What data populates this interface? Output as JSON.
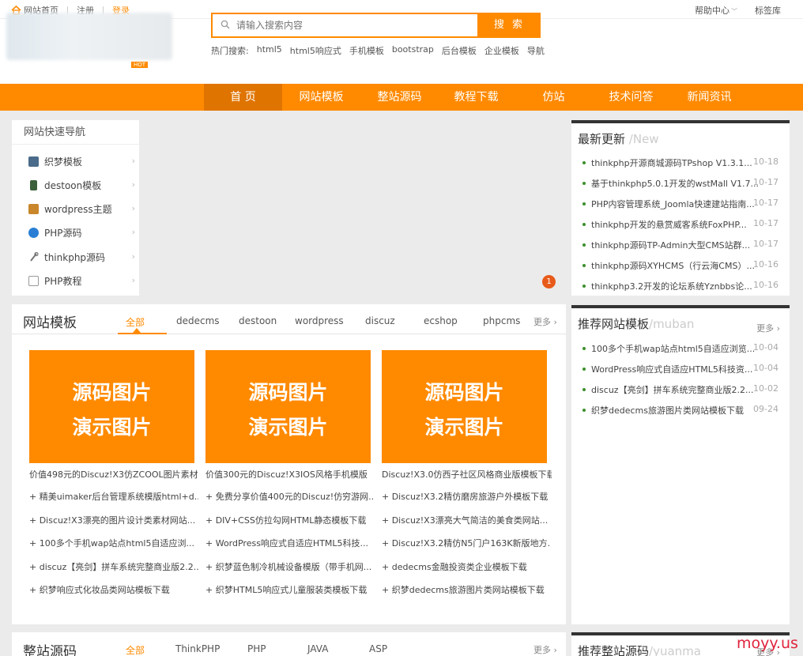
{
  "topbar": {
    "home": "网站首页",
    "register": "注册",
    "login": "登录",
    "help": "帮助中心",
    "help_chevron": "﹀",
    "tags": "标签库"
  },
  "header": {
    "hot_badge": "HOT",
    "search_placeholder": "请输入搜索内容",
    "search_button": "搜 索",
    "hot_label": "热门搜索:",
    "hot_words": [
      "html5",
      "html5响应式",
      "手机模板",
      "bootstrap",
      "后台模板",
      "企业模板",
      "导航"
    ]
  },
  "nav": [
    "首 页",
    "网站模板",
    "整站源码",
    "教程下载",
    "仿站",
    "技术问答",
    "新闻资讯"
  ],
  "quicknav": {
    "title": "网站快速导航",
    "items": [
      {
        "label": "织梦模板",
        "icon": "monitor-icon",
        "color": "#4a6b8a"
      },
      {
        "label": "destoon模板",
        "icon": "phone-icon",
        "color": "#3b5f3a"
      },
      {
        "label": "wordpress主题",
        "icon": "picture-icon",
        "color": "#c9862b"
      },
      {
        "label": "PHP源码",
        "icon": "help-circle-icon",
        "color": "#2a7fd4"
      },
      {
        "label": "thinkphp源码",
        "icon": "tool-icon",
        "color": "#777777"
      },
      {
        "label": "PHP教程",
        "icon": "document-icon",
        "color": "#999999"
      }
    ]
  },
  "banner": {
    "slide_indicator": "1"
  },
  "newest": {
    "title": "最新更新",
    "title_en": "/New",
    "items": [
      {
        "text": "thinkphp开源商城源码TPshop V1.3.1...",
        "date": "10-18"
      },
      {
        "text": "基于thinkphp5.0.1开发的wstMall V1.7...",
        "date": "10-17"
      },
      {
        "text": "PHP内容管理系统_Joomla快速建站指南...",
        "date": "10-17"
      },
      {
        "text": "thinkphp开发的悬赏威客系统FoxPHP...",
        "date": "10-17"
      },
      {
        "text": "thinkphp源码TP-Admin大型CMS站群...",
        "date": "10-17"
      },
      {
        "text": "thinkphp源码XYHCMS（行云海CMS）...",
        "date": "10-16"
      },
      {
        "text": "thinkphp3.2开发的论坛系统Yznbbs论...",
        "date": "10-16"
      }
    ]
  },
  "templates": {
    "title": "网站模板",
    "tabs": [
      "全部",
      "dedecms",
      "destoon",
      "wordpress",
      "discuz",
      "ecshop",
      "phpcms"
    ],
    "more": "更多 ›",
    "thumbs": [
      {
        "line1": "源码图片",
        "line2": "演示图片",
        "caption": "价值498元的Discuz!X3仿ZCOOL图片素材"
      },
      {
        "line1": "源码图片",
        "line2": "演示图片",
        "caption": "价值300元的Discuz!X3IOS风格手机模版"
      },
      {
        "line1": "源码图片",
        "line2": "演示图片",
        "caption": "Discuz!X3.0仿西子社区风格商业版模板下载"
      }
    ],
    "columns": [
      [
        "+ 精美uimaker后台管理系统模版html+d...",
        "+ Discuz!X3漂亮的图片设计类素材网站...",
        "+ 100多个手机wap站点html5自适应浏...",
        "+ discuz【亮剑】拼车系统完整商业版2.2...",
        "+ 织梦响应式化妆品类网站模板下载"
      ],
      [
        "+ 免费分享价值400元的Discuz!仿穷游网...",
        "+ DIV+CSS仿拉勾网HTML静态模板下载",
        "+ WordPress响应式自适应HTML5科技...",
        "+ 织梦蓝色制冷机械设备模版（带手机网...",
        "+ 织梦HTML5响应式儿童服装类模板下载"
      ],
      [
        "+ Discuz!X3.2精仿磨房旅游户外模板下载",
        "+ Discuz!X3漂亮大气简洁的美食类网站...",
        "+ Discuz!X3.2精仿N5门户163K新版地方...",
        "+ dedecms金融投资类企业模板下载",
        "+ 织梦dedecms旅游图片类网站模板下载"
      ]
    ]
  },
  "recommend": {
    "title": "推荐网站模板",
    "title_en": "/muban",
    "more": "更多 ›",
    "items": [
      {
        "text": "100多个手机wap站点html5自适应浏览...",
        "date": "10-04"
      },
      {
        "text": "WordPress响应式自适应HTML5科技资...",
        "date": "10-04"
      },
      {
        "text": "discuz【亮剑】拼车系统完整商业版2.2...",
        "date": "10-02"
      },
      {
        "text": "织梦dedecms旅游图片类网站模板下载",
        "date": "09-24"
      }
    ]
  },
  "source": {
    "title": "整站源码",
    "tabs": [
      "全部",
      "ThinkPHP",
      "PHP",
      "JAVA",
      "ASP"
    ],
    "more": "更多 ›"
  },
  "recommend_source": {
    "title": "推荐整站源码",
    "title_en": "/yuanma",
    "more": "更多 ›"
  },
  "watermark": "moyy.us",
  "colors": {
    "accent": "#ff8a00",
    "nav_active": "#e07400",
    "bullet": "#3a8f2a"
  }
}
